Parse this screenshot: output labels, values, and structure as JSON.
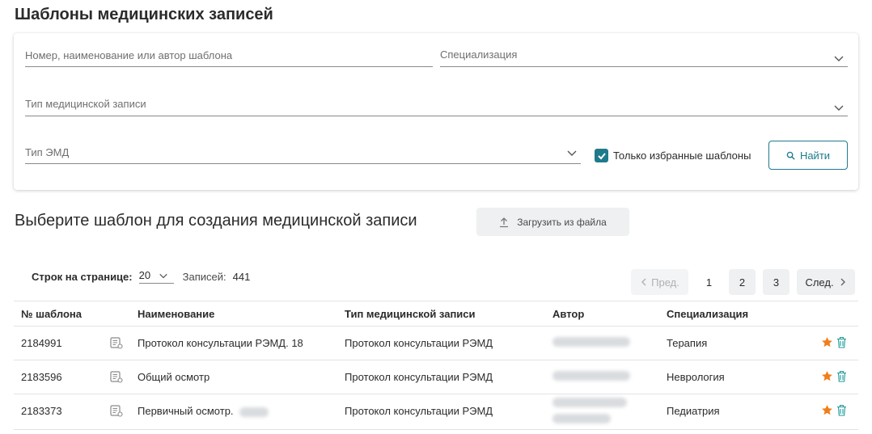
{
  "page": {
    "title": "Шаблоны медицинских записей"
  },
  "filters": {
    "search_placeholder": "Номер, наименование или автор шаблона",
    "specialization_placeholder": "Специализация",
    "record_type_placeholder": "Тип медицинской записи",
    "emd_type_placeholder": "Тип ЭМД",
    "favorites_only_label": "Только избранные шаблоны",
    "favorites_only_checked": true,
    "find_label": "Найти"
  },
  "section": {
    "title": "Выберите шаблон для создания медицинской записи",
    "upload_label": "Загрузить из файла"
  },
  "pagination": {
    "rows_per_page_label": "Строк на странице:",
    "rows_per_page_value": "20",
    "records_label": "Записей:",
    "records_count": "441",
    "prev_label": "Пред.",
    "next_label": "След.",
    "pages": [
      "1",
      "2",
      "3"
    ],
    "current_page": "1"
  },
  "table": {
    "columns": [
      "№ шаблона",
      "Наименование",
      "Тип медицинской записи",
      "Автор",
      "Специализация"
    ],
    "rows": [
      {
        "number": "2184991",
        "name": "Протокол консультации РЭМД. 18",
        "type": "Протокол консультации РЭМД",
        "specialization": "Терапия",
        "favorite": true
      },
      {
        "number": "2183596",
        "name": "Общий осмотр",
        "type": "Протокол консультации РЭМД",
        "specialization": "Неврология",
        "favorite": true
      },
      {
        "number": "2183373",
        "name": "Первичный осмотр.",
        "type": "Протокол консультации РЭМД",
        "specialization": "Педиатрия",
        "favorite": true
      }
    ]
  },
  "colors": {
    "accent": "#1f7a8c",
    "star": "#f07e1b",
    "trash": "#1f9a9a"
  },
  "icons": {
    "search": "search-icon",
    "upload": "upload-icon",
    "chevron": "chevron-down-icon",
    "template": "template-doc-icon",
    "star": "star-icon",
    "trash": "trash-icon"
  }
}
